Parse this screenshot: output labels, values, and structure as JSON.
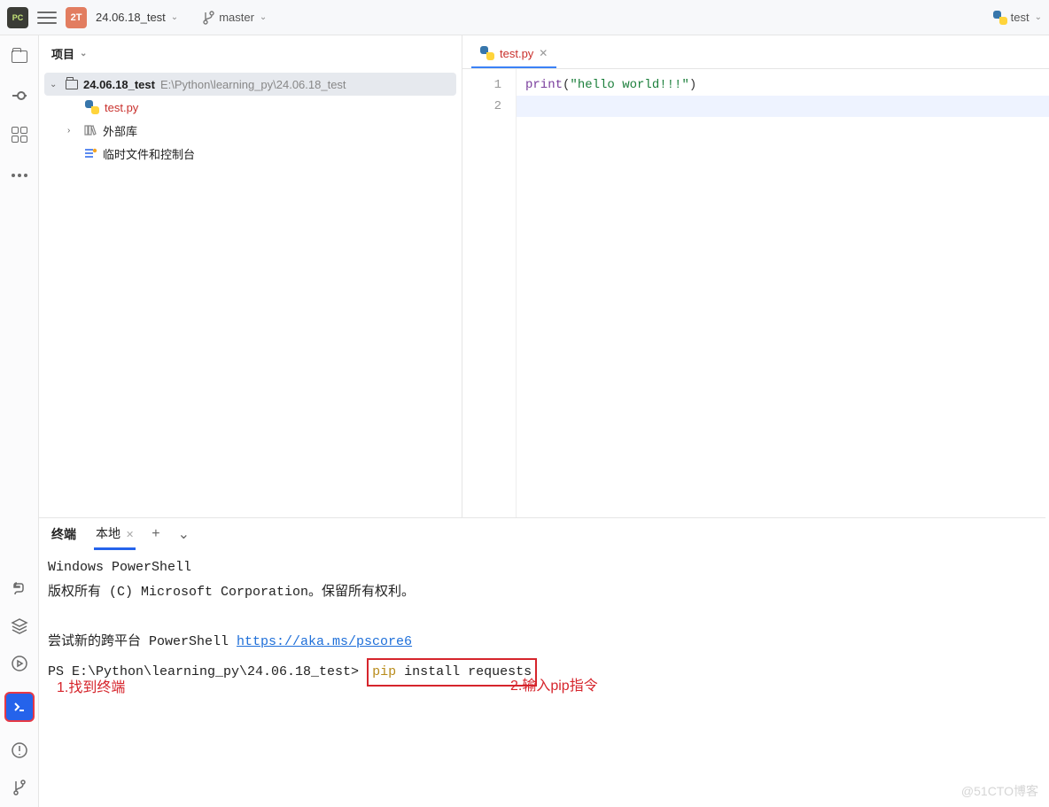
{
  "topbar": {
    "app_badge": "PC",
    "project_badge": "2T",
    "project_name": "24.06.18_test",
    "branch": "master",
    "run_config": "test"
  },
  "project_panel": {
    "title": "项目",
    "root": {
      "name": "24.06.18_test",
      "path": "E:\\Python\\learning_py\\24.06.18_test"
    },
    "file": "test.py",
    "external_lib": "外部库",
    "scratches": "临时文件和控制台"
  },
  "editor": {
    "tab_label": "test.py",
    "lines": [
      "1",
      "2"
    ],
    "code_fn": "print",
    "code_open": "(",
    "code_str": "\"hello world!!!\"",
    "code_close": ")"
  },
  "terminal": {
    "label": "终端",
    "tab": "本地",
    "line1": "Windows PowerShell",
    "line2": "版权所有 (C) Microsoft Corporation。保留所有权利。",
    "line3a": "尝试新的跨平台 PowerShell ",
    "line3_link": "https://aka.ms/pscore6",
    "prompt": "PS E:\\Python\\learning_py\\24.06.18_test> ",
    "cmd_pip": "pip",
    "cmd_rest": " install requests",
    "annot1": "1.找到终端",
    "annot2": "2.输入pip指令"
  },
  "watermark": "@51CTO博客"
}
